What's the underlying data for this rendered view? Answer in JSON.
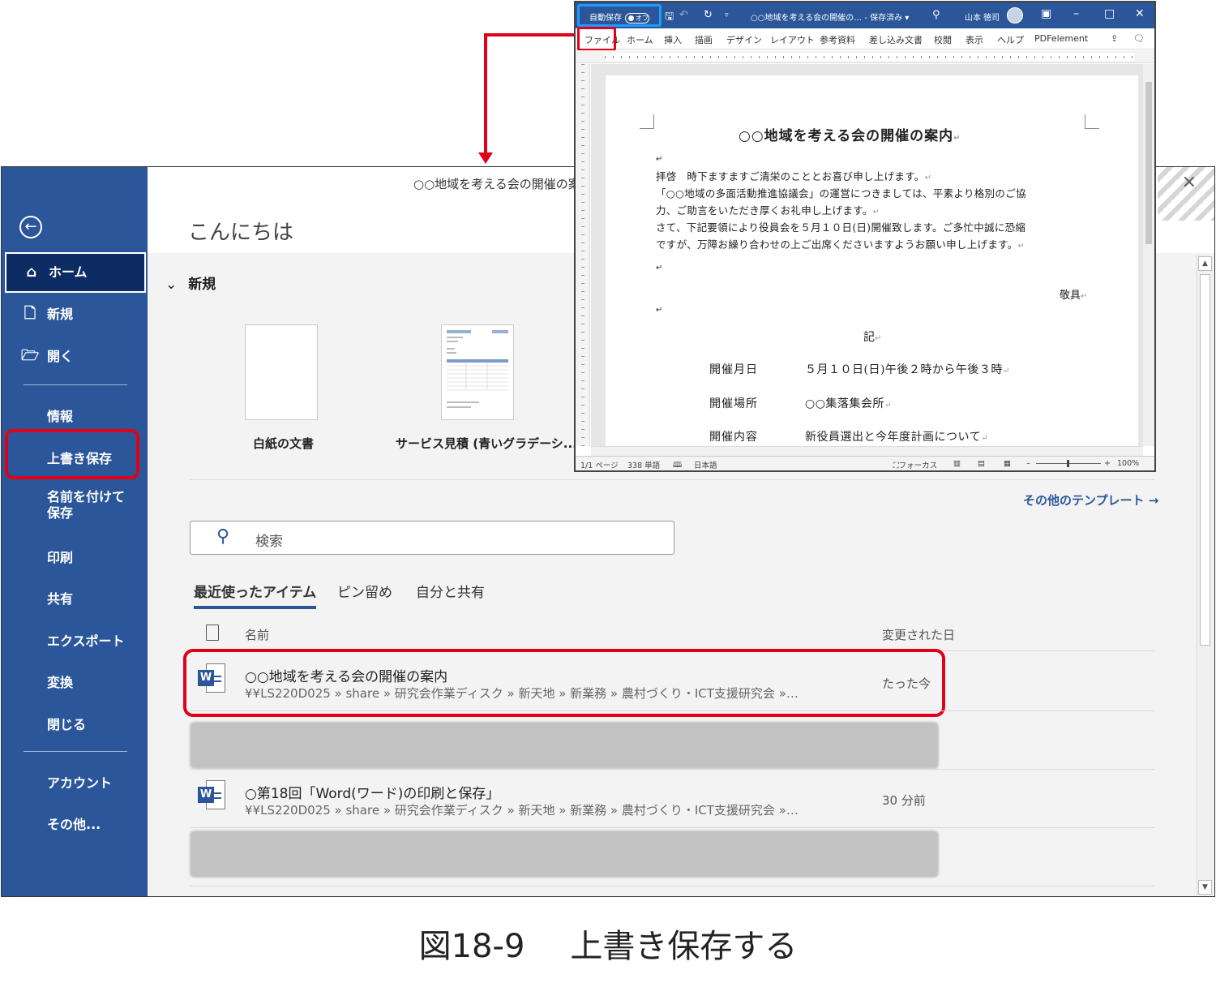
{
  "backstage": {
    "title": "○○地域を考える会の開催の案",
    "close": "×",
    "greeting": "こんにちは",
    "nav": {
      "back": "←",
      "home": "ホーム",
      "new": "新規",
      "open": "開く",
      "info": "情報",
      "save": "上書き保存",
      "save_as": "名前を付けて保存",
      "print": "印刷",
      "share": "共有",
      "export": "エクスポート",
      "transform": "変換",
      "close": "閉じる",
      "account": "アカウント",
      "more": "その他..."
    },
    "new_section": {
      "heading": "新規",
      "templates": [
        {
          "label": "白紙の文書"
        },
        {
          "label": "サービス見積 (青いグラデーシ..."
        }
      ],
      "more_templates": "その他のテンプレート →"
    },
    "search": {
      "placeholder": "検索"
    },
    "tabs": [
      "最近使ったアイテム",
      "ピン留め",
      "自分と共有"
    ],
    "columns": {
      "name": "名前",
      "modified": "変更された日"
    },
    "files": [
      {
        "name": "○○地域を考える会の開催の案内",
        "path": "¥¥LS220D025 » share » 研究会作業ディスク » 新天地 » 新業務 » 農村づくり・ICT支援研究会 »…",
        "modified": "たった今"
      },
      {
        "name": "○第18回「Word(ワード)の印刷と保存」",
        "path": "¥¥LS220D025 » share » 研究会作業ディスク » 新天地 » 新業務 » 農村づくり・ICT支援研究会 »…",
        "modified": "30 分前"
      }
    ]
  },
  "word": {
    "autosave_label": "自動保存",
    "autosave_state": "オフ",
    "doc_title": "○○地域を考える会の開催の… - 保存済み ▾",
    "user": "山本 徳司",
    "ribbon_tabs": [
      "ファイル",
      "ホーム",
      "挿入",
      "描画",
      "デザイン",
      "レイアウト",
      "参考資料",
      "差し込み文書",
      "校閲",
      "表示",
      "ヘルプ",
      "PDFelement"
    ],
    "document": {
      "title": "○○地域を考える会の開催の案内",
      "paragraphs": [
        "拝啓　時下ますますご清栄のこととお喜び申し上げます。",
        "「○○地域の多面活動推進協議会」の運営につきましては、平素より格別のご協",
        "力、ご助言をいただき厚くお礼申し上げます。",
        "さて、下記要領により役員会を５月１０日(日)開催致します。ご多忙中誠に恐縮",
        "ですが、万障お繰り合わせの上ご出席くださいますようお願い申し上げます。"
      ],
      "closing": "敬具",
      "ki": "記",
      "rows": [
        {
          "label": "開催月日",
          "value": "５月１０日(日)午後２時から午後３時"
        },
        {
          "label": "開催場所",
          "value": "○○集落集会所"
        },
        {
          "label": "開催内容",
          "value": "新役員選出と今年度計画について"
        }
      ]
    },
    "status": {
      "page": "1/1 ページ",
      "words": "338 単語",
      "language": "日本語",
      "focus": "フォーカス",
      "zoom": "100%"
    }
  },
  "caption": {
    "number": "図18-9",
    "text": "上書き保存する"
  }
}
